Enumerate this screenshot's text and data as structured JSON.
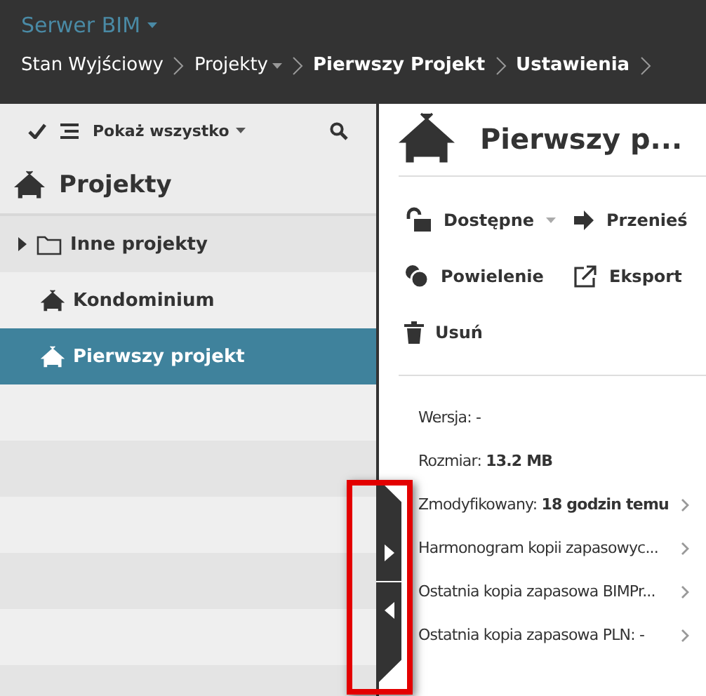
{
  "app": {
    "title": "Serwer BIM"
  },
  "breadcrumbs": [
    {
      "label": "Stan Wyjściowy",
      "current": false,
      "dropdown": false
    },
    {
      "label": "Projekty",
      "current": false,
      "dropdown": true
    },
    {
      "label": "Pierwszy Projekt",
      "current": true,
      "dropdown": false
    },
    {
      "label": "Ustawienia",
      "current": true,
      "dropdown": false
    }
  ],
  "toolbar": {
    "filter": "Pokaż wszystko"
  },
  "tree": {
    "title": "Projekty",
    "items": [
      {
        "label": "Inne projekty",
        "kind": "folder",
        "selected": false,
        "expanded": false
      },
      {
        "label": "Kondominium",
        "kind": "project",
        "selected": false
      },
      {
        "label": "Pierwszy projekt",
        "kind": "project",
        "selected": true
      }
    ]
  },
  "detail": {
    "title": "Pierwszy p...",
    "actions": [
      {
        "label": "Dostępne",
        "kind": "unlock",
        "dropdown": true
      },
      {
        "label": "Przenieś",
        "kind": "move",
        "dropdown": false
      },
      {
        "label": "Powielenie",
        "kind": "duplicate",
        "dropdown": false
      },
      {
        "label": "Eksport",
        "kind": "export",
        "dropdown": false
      },
      {
        "label": "Usuń",
        "kind": "delete",
        "dropdown": false
      }
    ],
    "info": [
      {
        "label": "Wersja: -",
        "chevron": false
      },
      {
        "label": "Rozmiar:",
        "value": "13.2 MB",
        "chevron": false
      },
      {
        "label": "Zmodyfikowany:",
        "value": "18 godzin temu",
        "chevron": true
      },
      {
        "label": "Harmonogram kopii zapasowyc...",
        "chevron": true
      },
      {
        "label": "Ostatnia kopia zapasowa BIMPr...",
        "chevron": true
      },
      {
        "label": "Ostatnia kopia zapasowa PLN: -",
        "chevron": true
      }
    ]
  }
}
